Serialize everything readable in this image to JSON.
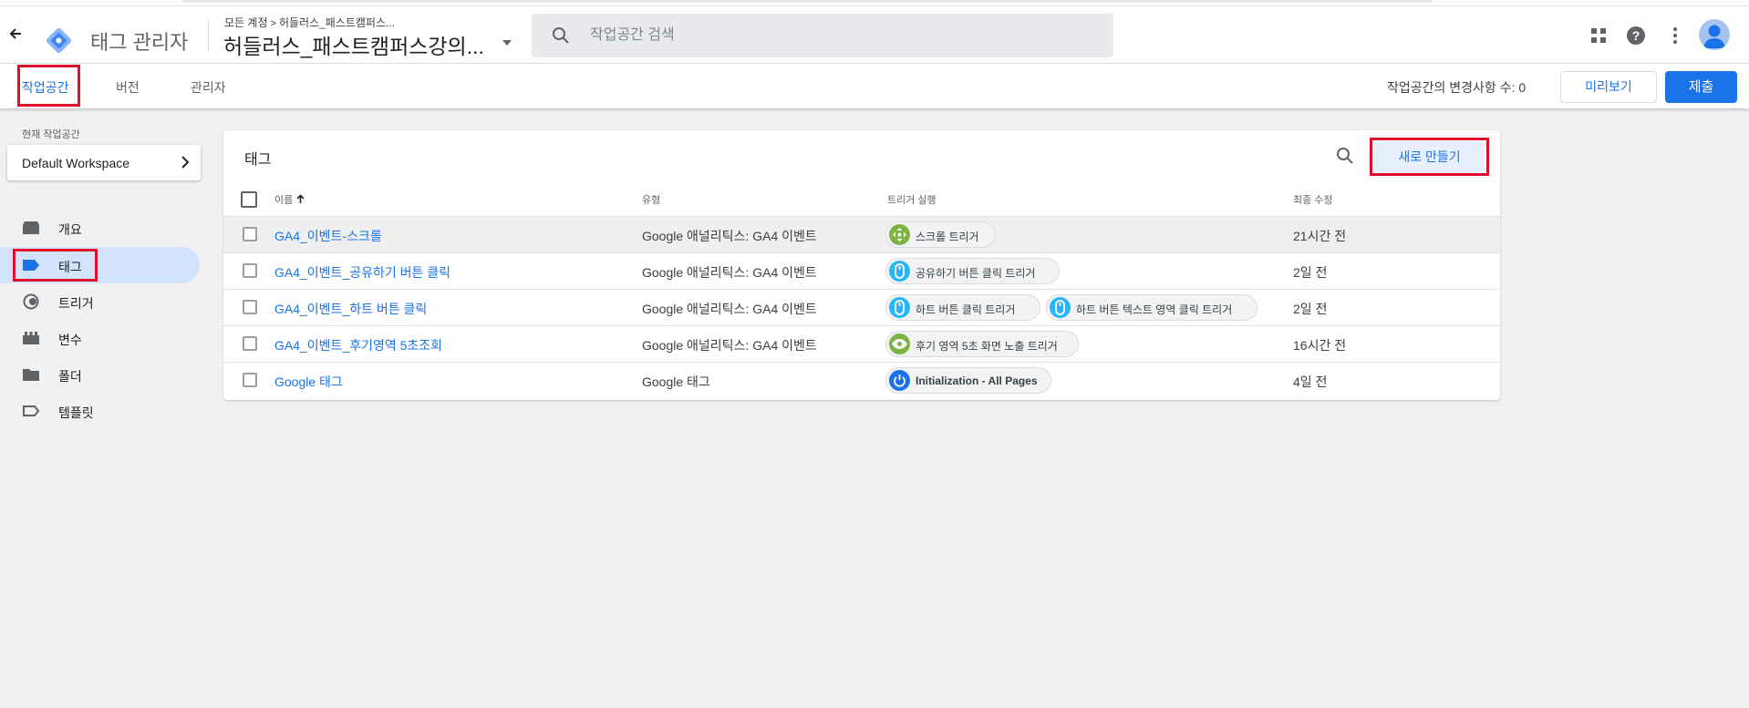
{
  "header": {
    "product_name": "태그 관리자",
    "breadcrumb": {
      "account": "모든 계정",
      "separator": ">",
      "container_short": "허들러스_패스트캠퍼스..."
    },
    "container_name": "허들러스_패스트캠퍼스강의...",
    "search_placeholder": "작업공간 검색",
    "icons": [
      "arrow-back-icon",
      "gtm-logo",
      "search-icon",
      "apps-grid-icon",
      "help-icon",
      "more-vert-icon",
      "avatar"
    ]
  },
  "nav": {
    "tabs": [
      {
        "label": "작업공간",
        "active": true
      },
      {
        "label": "버전",
        "active": false
      },
      {
        "label": "관리자",
        "active": false
      }
    ],
    "changes_label": "작업공간의 변경사항 수: 0",
    "preview_label": "미리보기",
    "submit_label": "제출"
  },
  "sidebar": {
    "current_workspace_label": "현재 작업공간",
    "workspace_name": "Default Workspace",
    "items": [
      {
        "label": "개요",
        "icon": "overview-icon",
        "active": false
      },
      {
        "label": "태그",
        "icon": "tag-icon",
        "active": true
      },
      {
        "label": "트리거",
        "icon": "trigger-icon",
        "active": false
      },
      {
        "label": "변수",
        "icon": "variable-icon",
        "active": false
      },
      {
        "label": "폴더",
        "icon": "folder-icon",
        "active": false
      },
      {
        "label": "템플릿",
        "icon": "template-icon",
        "active": false
      }
    ]
  },
  "main": {
    "card_title": "태그",
    "new_button": "새로 만들기",
    "columns": {
      "name": "이름",
      "sort_icon": "arrow-up-icon",
      "type": "유형",
      "triggers": "트리거 실행",
      "modified": "최종 수정"
    },
    "rows": [
      {
        "name": "GA4_이벤트-스크롤",
        "type": "Google 애널리틱스: GA4 이벤트",
        "triggers": [
          {
            "label": "스크롤 트리거",
            "icon": "scroll-icon",
            "color": "#7cb342"
          }
        ],
        "modified": "21시간 전"
      },
      {
        "name": "GA4_이벤트_공유하기 버튼 클릭",
        "type": "Google 애널리틱스: GA4 이벤트",
        "triggers": [
          {
            "label": "공유하기 버튼 클릭 트리거",
            "icon": "mouse-icon",
            "color": "#29b6f6"
          }
        ],
        "modified": "2일 전"
      },
      {
        "name": "GA4_이벤트_하트 버튼 클릭",
        "type": "Google 애널리틱스: GA4 이벤트",
        "triggers": [
          {
            "label": "하트 버튼 클릭 트리거",
            "icon": "mouse-icon",
            "color": "#29b6f6"
          },
          {
            "label": "하트 버튼 텍스트 영역 클릭 트리거",
            "icon": "mouse-icon",
            "color": "#29b6f6"
          }
        ],
        "modified": "2일 전"
      },
      {
        "name": "GA4_이벤트_후기영역 5초조회",
        "type": "Google 애널리틱스: GA4 이벤트",
        "triggers": [
          {
            "label": "후기 영역 5초 화면 노출 트리거",
            "icon": "eye-icon",
            "color": "#7cb342"
          }
        ],
        "modified": "16시간 전"
      },
      {
        "name": "Google 태그",
        "type": "Google 태그",
        "triggers": [
          {
            "label": "Initialization - All Pages",
            "icon": "power-icon",
            "color": "#1a73e8"
          }
        ],
        "modified": "4일 전"
      }
    ]
  },
  "colors": {
    "accent": "#1a73e8",
    "highlight": "#e0102a",
    "active_nav_bg": "#d2e3fc"
  }
}
